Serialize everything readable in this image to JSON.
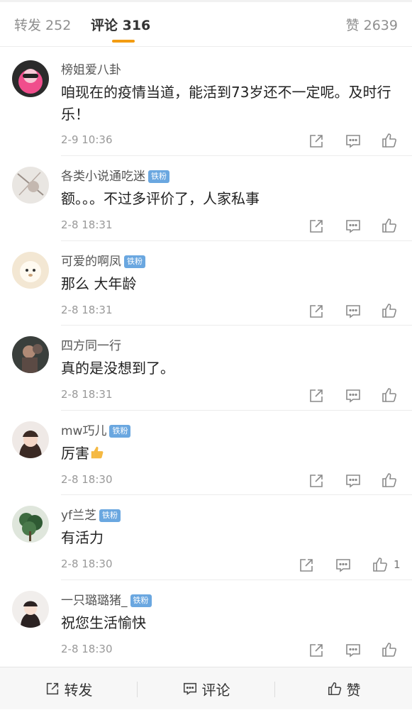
{
  "tabs": {
    "repost_label": "转发 252",
    "comment_label": "评论 316",
    "like_label": "赞 2639"
  },
  "comments": [
    {
      "user": "榜姐爱八卦",
      "badge": "",
      "text": "咱现在的疫情当道，能活到73岁还不一定呢。及时行乐！",
      "time": "2-9 10:36",
      "likes": ""
    },
    {
      "user": "各类小说通吃迷",
      "badge": "铁粉",
      "text": "额。。。不过多评价了，人家私事",
      "time": "2-8 18:31",
      "likes": ""
    },
    {
      "user": "可爱的啊凤",
      "badge": "铁粉",
      "text": "那么 大年龄",
      "time": "2-8 18:31",
      "likes": ""
    },
    {
      "user": "四方同一行",
      "badge": "",
      "text": "真的是没想到了。",
      "time": "2-8 18:31",
      "likes": ""
    },
    {
      "user": "mw巧儿",
      "badge": "铁粉",
      "text": "厉害",
      "time": "2-8 18:30",
      "likes": ""
    },
    {
      "user": "yf兰芝",
      "badge": "铁粉",
      "text": "有活力",
      "time": "2-8 18:30",
      "likes": "1"
    },
    {
      "user": "一只璐璐猪_",
      "badge": "铁粉",
      "text": "祝您生活愉快",
      "time": "2-8 18:30",
      "likes": ""
    }
  ],
  "bottom_bar": {
    "repost_label": "转发",
    "comment_label": "评论",
    "like_label": "赞"
  },
  "colors": {
    "tab_underline": "#f39c12",
    "badge_bg": "#6aa7e0",
    "thumb_emoji": "#f5b942"
  },
  "icons": {
    "action_share": "share-icon",
    "action_comment": "comment-icon",
    "action_like": "like-icon",
    "emoji_after_text": "thumbs-up-emoji"
  }
}
